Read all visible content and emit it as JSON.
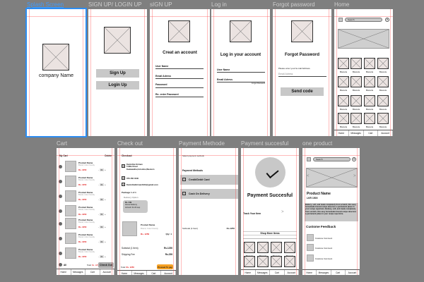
{
  "frames": {
    "splash": {
      "label": "Splash Screen",
      "company": "company Name"
    },
    "signup_login": {
      "label": "SIGN UP/ LOGIN UP",
      "signup": "Sign Up",
      "login": "Login Up"
    },
    "signup": {
      "label": "sIGN UP",
      "title": "Creat an account",
      "fields": [
        "User Name",
        "Email Adress",
        "Password",
        "Re- enter Password"
      ]
    },
    "login": {
      "label": "Log in",
      "title": "Log in your account",
      "fields": [
        "User Name",
        "Email Adress"
      ],
      "forgot": "Forgot Password"
    },
    "forgot": {
      "label": "Forgot password",
      "title": "Forgot Password",
      "hint": "Please enter your E-mail Address.",
      "placeholder": "Email Adress",
      "button": "Send code"
    },
    "home": {
      "label": "Home",
      "search": "Search",
      "close": "✕",
      "tile_label": "Biscuits"
    },
    "cart": {
      "label": "Cart",
      "heading": "My Cart",
      "delete": "Delete",
      "item": {
        "name": "Product Name",
        "brand": "Brand, Color Family",
        "price": "Rs. 1250",
        "qty": "01",
        "minus": "-",
        "plus": "+"
      },
      "all": "All",
      "total_label": "Total:",
      "total": "Rs. 1250",
      "checkout": "Check Out"
    },
    "checkout": {
      "label": "Check out",
      "heading": "Checkout",
      "address": [
        "Kanishka Sriman",
        "5 Mile Road",
        "Kadawatha,Colombo,Western"
      ],
      "phone": "076 456 4040",
      "email": "KanishkaSriman1919@gmail.com",
      "package": "Package 1 of 1",
      "delivery_option": "Delivery Option",
      "delivery": [
        "Rs. 249",
        "Home Delivery",
        "Arrived: 01-04 sep"
      ],
      "product_name": "Product Name",
      "brand": "Brand, Color Family",
      "price": "Rs. 1250",
      "qty": "Qty: 1",
      "subtotal_label": "Subtotal (1 Item)",
      "subtotal": "Rs.1250",
      "shipping_label": "Shipping Fee",
      "shipping": "Rs.259",
      "total_label": "Total:",
      "total": "Rs. 1250",
      "proceed": "Proceed To pay",
      "proceed_color": "#f5a023"
    },
    "payment_method": {
      "label": "Payment Methode",
      "heading": "Select payment methods",
      "section": "Payment Methods",
      "options": [
        "Credit/Debit Card",
        "Cash On Delivery"
      ],
      "subtotal_label": "Subtotal (1 Item)",
      "subtotal": "Rs.1250"
    },
    "payment_success": {
      "label": "Payment succesful",
      "title": "Payment Succesful",
      "track": "Track Your Item",
      "arrow": ">",
      "shop_more": "Shop More Items",
      "tile_label": "Biscuits"
    },
    "product": {
      "label": "one product",
      "search": "Search",
      "close": "✕",
      "prev": "<",
      "next": ">",
      "name": "Product Name",
      "price": "LKR 1500",
      "description": "Buttery, soft, and made completely from scratch, this easy homemade biscuit recipe deserves a permanent place in your recipe repertoire. Buttery, soft, and made completely from scratch, this easy homemade biscuit recipe deserves a permanent place in your recipe repertoire.",
      "feedback_title": "Custome Feedback",
      "comments": [
        "Custome Comment",
        "Custome Comment",
        "Custome Comment"
      ]
    }
  },
  "nav": [
    "Home",
    "Messages",
    "Cart",
    "Account"
  ],
  "colors": {
    "canvas": "#7f7f7f",
    "guide": "#ff3c3c",
    "selection": "#2d8cf0",
    "price": "#e01010"
  }
}
